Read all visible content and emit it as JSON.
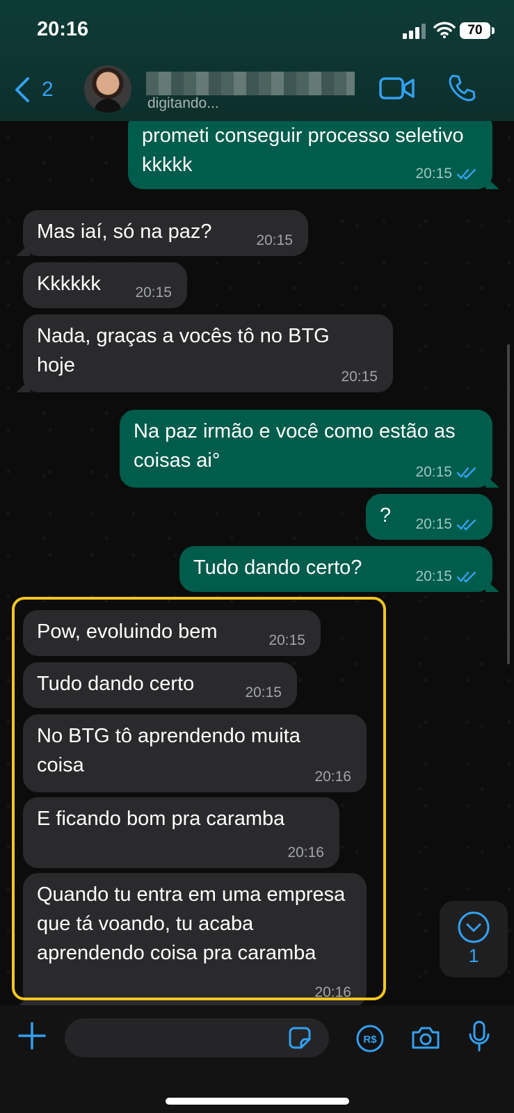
{
  "status_bar": {
    "time": "20:16",
    "battery": "70"
  },
  "header": {
    "back_count": "2",
    "contact_status": "digitando..."
  },
  "messages": [
    {
      "dir": "out",
      "text": "prometi conseguir processo seletivo kkkkk",
      "time": "20:15"
    },
    {
      "dir": "in",
      "text": "Mas iaí, só na paz?",
      "time": "20:15"
    },
    {
      "dir": "in",
      "text": "Kkkkkk",
      "time": "20:15"
    },
    {
      "dir": "in",
      "text": "Nada, graças a vocês tô no BTG hoje",
      "time": "20:15"
    },
    {
      "dir": "out",
      "text": "Na paz irmão e você como estão as coisas ai°",
      "time": "20:15"
    },
    {
      "dir": "out",
      "text": "?",
      "time": "20:15"
    },
    {
      "dir": "out",
      "text": "Tudo dando certo?",
      "time": "20:15"
    },
    {
      "dir": "in",
      "text": "Pow, evoluindo bem",
      "time": "20:15"
    },
    {
      "dir": "in",
      "text": "Tudo dando certo",
      "time": "20:15"
    },
    {
      "dir": "in",
      "text": "No BTG tô aprendendo muita coisa",
      "time": "20:16"
    },
    {
      "dir": "in",
      "text": "E ficando bom pra caramba",
      "time": "20:16"
    },
    {
      "dir": "in",
      "text": "Quando tu entra em uma empresa que tá voando, tu acaba aprendendo coisa pra caramba",
      "time": "20:16"
    }
  ],
  "unread_badge": "1",
  "input": {
    "placeholder": ""
  },
  "colors": {
    "accent": "#33a1f2",
    "outgoing": "#005c4b",
    "incoming": "#2a2a2c",
    "highlight": "#f3c61f"
  },
  "icons": [
    "back-icon",
    "video-icon",
    "phone-icon",
    "plus-icon",
    "sticker-icon",
    "pix-icon",
    "camera-icon",
    "mic-icon",
    "chevron-down-icon",
    "double-check-icon"
  ]
}
